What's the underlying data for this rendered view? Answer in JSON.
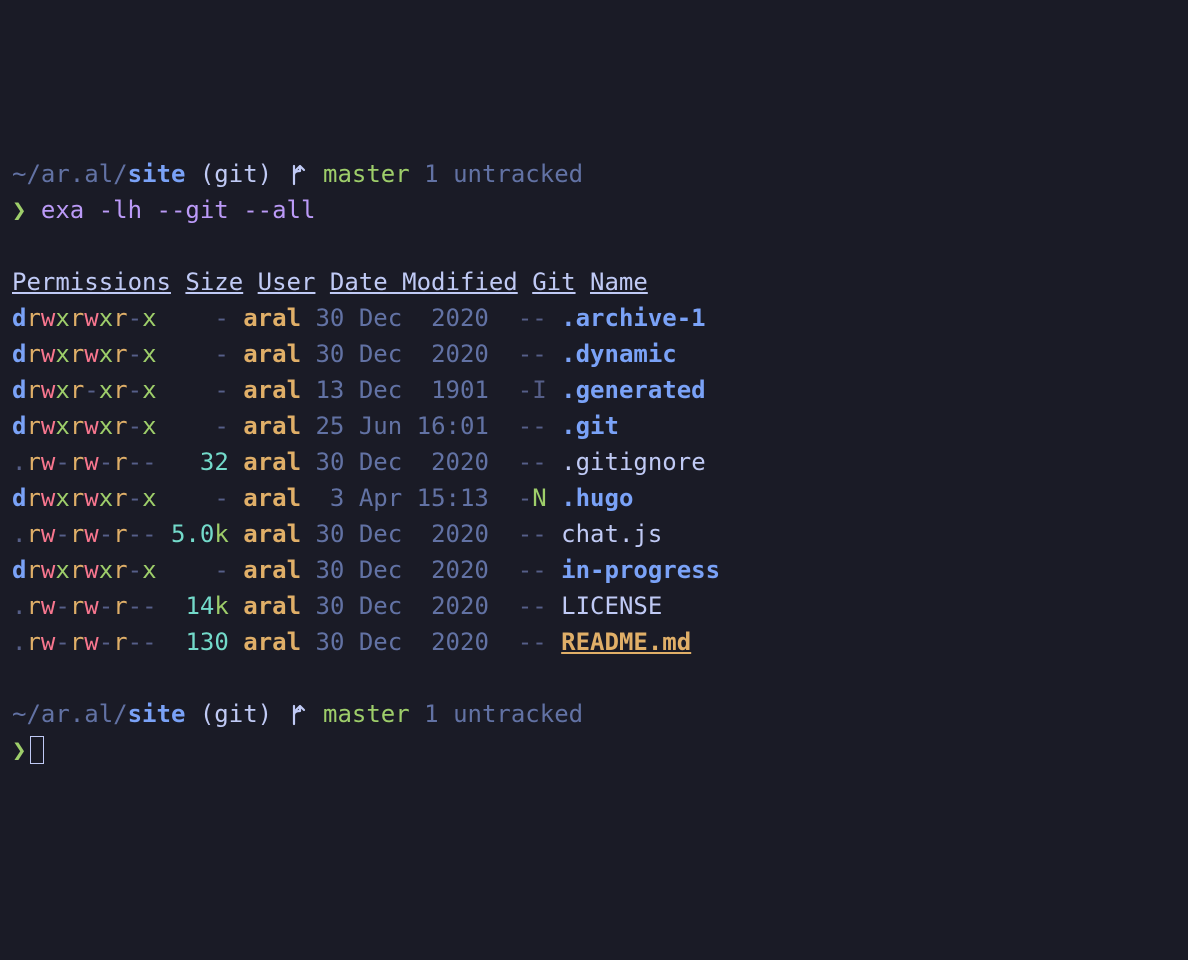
{
  "prompt1": {
    "path_prefix": "~/ar.al/",
    "dir": "site",
    "vcs": "(git)",
    "branch": "master",
    "ahead": "1",
    "status": "untracked",
    "char": "❯",
    "command": "exa -lh --git --all"
  },
  "headers": {
    "permissions": "Permissions",
    "size": "Size",
    "user": "User",
    "date": "Date Modified",
    "git": "Git",
    "name": "Name"
  },
  "rows": [
    {
      "type": "d",
      "perm": "rwxrwxr-x",
      "size": "-",
      "user": "aral",
      "date": "30 Dec  2020",
      "git": "--",
      "name": ".archive-1",
      "name_style": "blue-name"
    },
    {
      "type": "d",
      "perm": "rwxrwxr-x",
      "size": "-",
      "user": "aral",
      "date": "30 Dec  2020",
      "git": "--",
      "name": ".dynamic",
      "name_style": "blue-name"
    },
    {
      "type": "d",
      "perm": "rwxr-xr-x",
      "size": "-",
      "user": "aral",
      "date": "13 Dec  1901",
      "git": "-I",
      "name": ".generated",
      "name_style": "blue-name"
    },
    {
      "type": "d",
      "perm": "rwxrwxr-x",
      "size": "-",
      "user": "aral",
      "date": "25 Jun 16:01",
      "git": "--",
      "name": ".git",
      "name_style": "blue-name"
    },
    {
      "type": ".",
      "perm": "rw-rw-r--",
      "size": "32",
      "user": "aral",
      "date": "30 Dec  2020",
      "git": "--",
      "name": ".gitignore",
      "name_style": "white"
    },
    {
      "type": "d",
      "perm": "rwxrwxr-x",
      "size": "-",
      "user": "aral",
      "date": " 3 Apr 15:13",
      "git": "-N",
      "name": ".hugo",
      "name_style": "blue-name"
    },
    {
      "type": ".",
      "perm": "rw-rw-r--",
      "size": "5.0k",
      "user": "aral",
      "date": "30 Dec  2020",
      "git": "--",
      "name": "chat.js",
      "name_style": "white"
    },
    {
      "type": "d",
      "perm": "rwxrwxr-x",
      "size": "-",
      "user": "aral",
      "date": "30 Dec  2020",
      "git": "--",
      "name": "in-progress",
      "name_style": "blue-name"
    },
    {
      "type": ".",
      "perm": "rw-rw-r--",
      "size": "14k",
      "user": "aral",
      "date": "30 Dec  2020",
      "git": "--",
      "name": "LICENSE",
      "name_style": "white"
    },
    {
      "type": ".",
      "perm": "rw-rw-r--",
      "size": "130",
      "user": "aral",
      "date": "30 Dec  2020",
      "git": "--",
      "name": "README.md",
      "name_style": "readme"
    }
  ],
  "prompt2": {
    "path_prefix": "~/ar.al/",
    "dir": "site",
    "vcs": "(git)",
    "branch": "master",
    "ahead": "1",
    "status": "untracked",
    "char": "❯"
  }
}
